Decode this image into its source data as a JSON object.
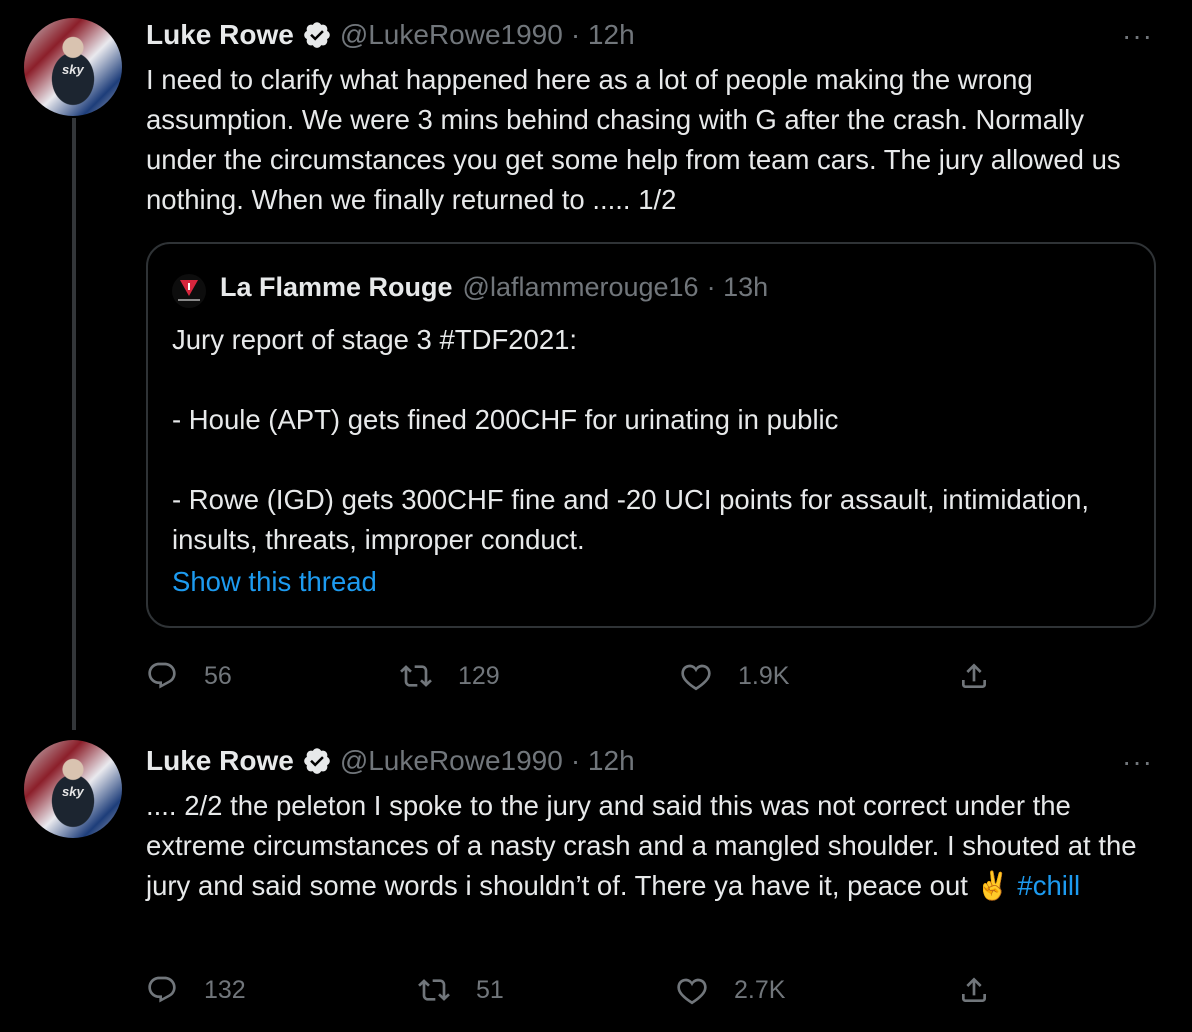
{
  "thread": [
    {
      "author": {
        "name": "Luke Rowe",
        "handle": "@LukeRowe1990",
        "time": "· 12h",
        "avatar_text": "sky"
      },
      "more": "···",
      "text": "I need to clarify what happened here as a lot of people making the wrong assumption. We were 3 mins behind chasing with G after the crash. Normally under the circumstances you get some help from team cars. The jury allowed us nothing. When we finally returned to ..... 1/2",
      "quote": {
        "author": {
          "name": "La Flamme Rouge",
          "handle": "@laflammerouge16",
          "time": "· 13h"
        },
        "text": "Jury report of stage 3 #TDF2021:\n\n- Houle (APT) gets fined 200CHF for urinating in public\n\n- Rowe (IGD) gets 300CHF fine and -20 UCI points for assault, intimidation, insults, threats, improper conduct.",
        "link": "Show this thread"
      },
      "stats": {
        "replies": "56",
        "retweets": "129",
        "likes": "1.9K"
      }
    },
    {
      "author": {
        "name": "Luke Rowe",
        "handle": "@LukeRowe1990",
        "time": "· 12h",
        "avatar_text": "sky"
      },
      "more": "···",
      "text": ".... 2/2 the peleton I spoke to the jury and said this was not correct under the extreme circumstances of a nasty crash and a mangled shoulder. I shouted at the jury and said some words i shouldn’t of. There ya have it, peace out ✌️",
      "hashtag": "#chill",
      "stats": {
        "replies": "132",
        "retweets": "51",
        "likes": "2.7K"
      }
    }
  ],
  "colors": {
    "background": "#000000",
    "text": "#e7e9ea",
    "secondary": "#71767b",
    "link": "#1d9bf0",
    "border": "#2f3336"
  },
  "icons": [
    "verified-icon",
    "more-icon",
    "reply-icon",
    "retweet-icon",
    "like-icon",
    "share-icon"
  ]
}
